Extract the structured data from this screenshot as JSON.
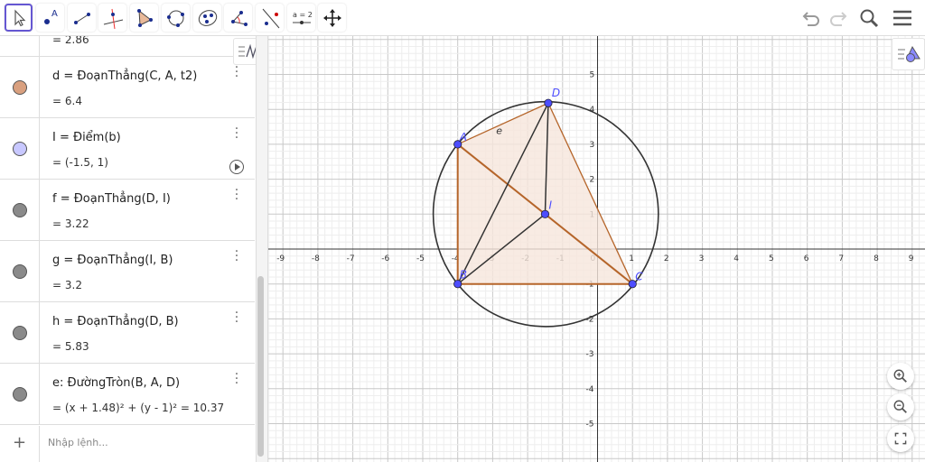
{
  "toolbar": {
    "tools": [
      "move",
      "point",
      "segment",
      "perpendicular-line",
      "polygon",
      "circle-through-3-points",
      "conic-through-5-points",
      "angle",
      "reflect-about-line",
      "slider",
      "move-graphics-view"
    ],
    "slider_label": "a = 2",
    "point_label": "A"
  },
  "algebra": {
    "partial_value": "= 2.86",
    "rows": [
      {
        "def": "d = ĐoạnThẳng(C, A, t2)",
        "value": "= 6.4",
        "color": "#d9a07f"
      },
      {
        "def": "I = Điểm(b)",
        "value": "= (-1.5, 1)",
        "color": "#c8c8ff",
        "play": true
      },
      {
        "def": "f = ĐoạnThẳng(D, I)",
        "value": "= 3.22",
        "color": "#8a8a8a"
      },
      {
        "def": "g = ĐoạnThẳng(I, B)",
        "value": "= 3.2",
        "color": "#8a8a8a"
      },
      {
        "def": "h = ĐoạnThẳng(D, B)",
        "value": "= 5.83",
        "color": "#8a8a8a"
      },
      {
        "def": "e: ĐườngTròn(B, A, D)",
        "value": "= (x + 1.48)² + (y - 1)² = 10.37",
        "color": "#8a8a8a"
      }
    ],
    "input_placeholder": "Nhập lệnh..."
  },
  "graph": {
    "x_ticks": [
      -9,
      -8,
      -7,
      -6,
      -5,
      -4,
      -3,
      -2,
      -1,
      0,
      1,
      2,
      3,
      4,
      5,
      6,
      7,
      8,
      9
    ],
    "y_ticks": [
      -5,
      -4,
      -3,
      -2,
      -1,
      1,
      2,
      3,
      4,
      5
    ],
    "points": {
      "A": [
        -4,
        3
      ],
      "B": [
        -4,
        -1
      ],
      "C": [
        1,
        -1
      ],
      "D": [
        -1.41,
        4.18
      ],
      "I": [
        -1.5,
        1
      ]
    },
    "circle": {
      "label": "e",
      "center": [
        -1.48,
        1
      ],
      "radius": 3.22
    },
    "colors": {
      "brown": "#b5652a",
      "black": "#333333",
      "point": "#4d4dff",
      "fill": "#f6e6dc"
    }
  }
}
